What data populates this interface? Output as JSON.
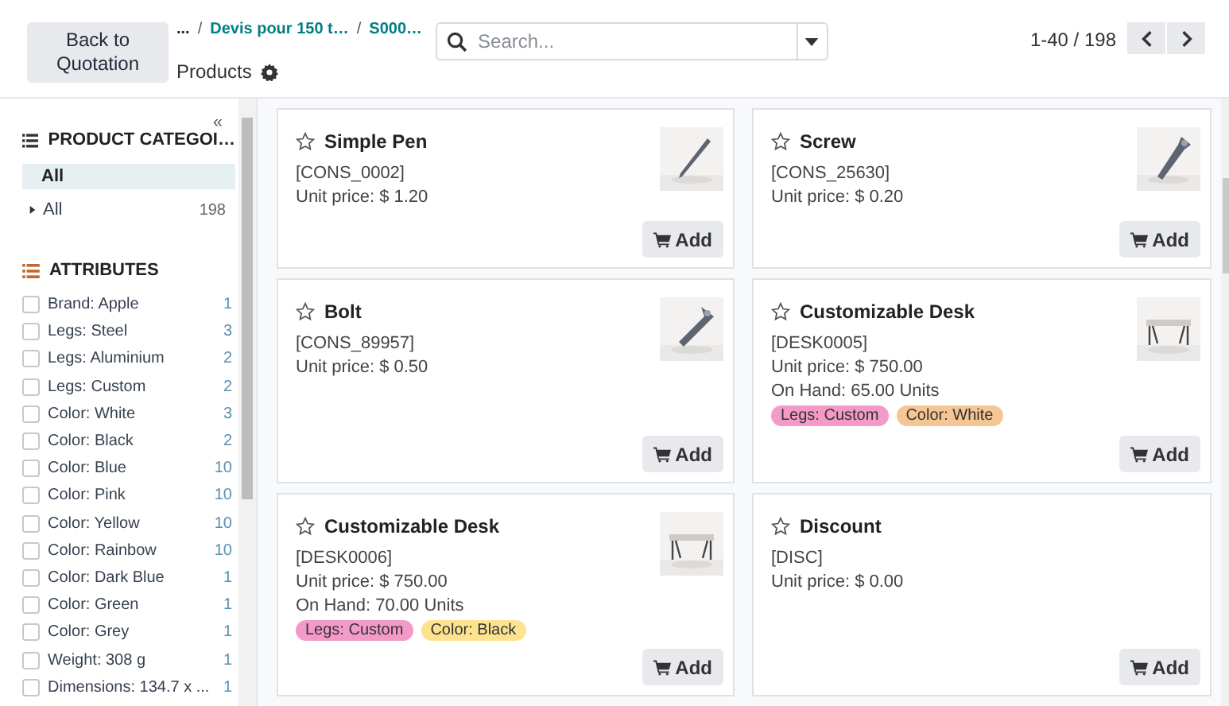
{
  "back_button": "Back to Quotation",
  "breadcrumb": {
    "items": [
      {
        "label": "..."
      },
      {
        "separator": "/",
        "label": "Devis pour 150 t…"
      },
      {
        "separator": "/",
        "label": "S000…"
      }
    ],
    "current": "Products"
  },
  "search": {
    "placeholder": "Search..."
  },
  "pager": {
    "range": "1-40 / 198"
  },
  "sidebar": {
    "collapse": "«",
    "categories": {
      "title": "PRODUCT CATEGOI…",
      "items": [
        {
          "label": "All",
          "selected": true
        },
        {
          "label": "All",
          "count": "198",
          "selected": false,
          "expanded": false
        }
      ]
    },
    "attributes": {
      "title": "ATTRIBUTES",
      "items": [
        {
          "label": "Brand: Apple",
          "count": "1",
          "checked": false
        },
        {
          "label": "Legs: Steel",
          "count": "3",
          "checked": false
        },
        {
          "label": "Legs: Aluminium",
          "count": "2",
          "checked": false
        },
        {
          "label": "Legs: Custom",
          "count": "2",
          "checked": false
        },
        {
          "label": "Color: White",
          "count": "3",
          "checked": false
        },
        {
          "label": "Color: Black",
          "count": "2",
          "checked": false
        },
        {
          "label": "Color: Blue",
          "count": "10",
          "checked": false
        },
        {
          "label": "Color: Pink",
          "count": "10",
          "checked": false
        },
        {
          "label": "Color: Yellow",
          "count": "10",
          "checked": false
        },
        {
          "label": "Color: Rainbow",
          "count": "10",
          "checked": false
        },
        {
          "label": "Color: Dark Blue",
          "count": "1",
          "checked": false
        },
        {
          "label": "Color: Green",
          "count": "1",
          "checked": false
        },
        {
          "label": "Color: Grey",
          "count": "1",
          "checked": false
        },
        {
          "label": "Weight: 308 g",
          "count": "1",
          "checked": false
        },
        {
          "label": "Dimensions: 134.7 x ...",
          "count": "1",
          "checked": false
        }
      ]
    }
  },
  "products": [
    {
      "name": "Simple Pen",
      "code": "[CONS_0002]",
      "price": "Unit price: $ 1.20",
      "favorite": false,
      "media": {
        "kind": "picture"
      },
      "button": "Add"
    },
    {
      "name": "Screw",
      "code": "[CONS_25630]",
      "price": "Unit price: $ 0.20",
      "favorite": false,
      "media": {
        "kind": "picture"
      },
      "button": "Add"
    },
    {
      "name": "Bolt",
      "code": "[CONS_89957]",
      "price": "Unit price: $ 0.50",
      "favorite": false,
      "media": {
        "kind": "picture"
      },
      "button": "Add"
    },
    {
      "name": "Customizable Desk",
      "code": "[DESK0005]",
      "price": "Unit price: $ 750.00",
      "stock": "On Hand: 65.00 Units",
      "tags": [
        {
          "label": "Legs: Custom",
          "color": "#f49ac8"
        },
        {
          "label": "Color: White",
          "color": "#f6c594"
        }
      ],
      "favorite": false,
      "media": {
        "kind": "picture"
      },
      "button": "Add"
    },
    {
      "name": "Customizable Desk",
      "code": "[DESK0006]",
      "price": "Unit price: $ 750.00",
      "stock": "On Hand: 70.00 Units",
      "tags": [
        {
          "label": "Legs: Custom",
          "color": "#f49ac8"
        },
        {
          "label": "Color: Black",
          "color": "#fde38f"
        }
      ],
      "favorite": false,
      "media": {
        "kind": "picture"
      },
      "button": "Add"
    },
    {
      "name": "Discount",
      "code": "[DISC]",
      "price": "Unit price: $ 0.00",
      "favorite": false,
      "button": "Add"
    }
  ]
}
